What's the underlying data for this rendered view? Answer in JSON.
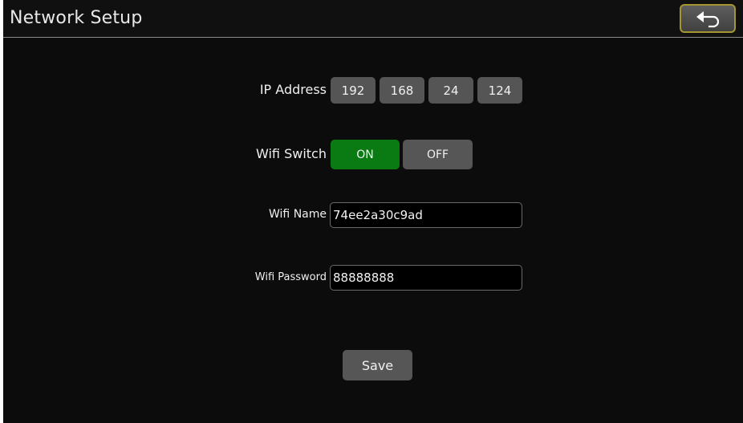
{
  "header": {
    "title": "Network Setup",
    "back_icon": "back-arrow-icon"
  },
  "ip_address": {
    "label": "IP Address",
    "octets": [
      "192",
      "168",
      "24",
      "124"
    ]
  },
  "wifi_switch": {
    "label": "Wifi Switch",
    "on_label": "ON",
    "off_label": "OFF",
    "selected": "ON",
    "on_color": "#0a7a12",
    "off_color": "#565656"
  },
  "wifi_name": {
    "label": "Wifi Name",
    "value": "74ee2a30c9ad"
  },
  "wifi_password": {
    "label": "Wifi Password",
    "value": "88888888"
  },
  "actions": {
    "save_label": "Save"
  },
  "colors": {
    "background": "#0c0c0c",
    "button": "#555555",
    "back_button_border": "#a3962e"
  }
}
